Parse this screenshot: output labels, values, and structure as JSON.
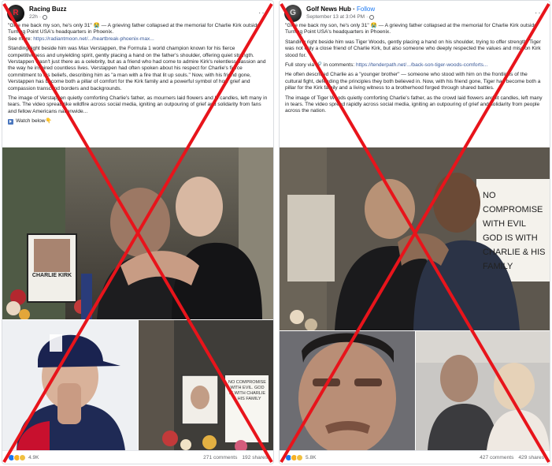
{
  "left": {
    "page_name": "Racing Buzz",
    "time": "22h",
    "quote": "\"Give me back my son, he's only 31\" 😭 — A grieving father collapsed at the memorial for Charlie Kirk outside Turning Point USA's headquarters in Phoenix.",
    "see_more_label": "See more:",
    "see_more_link": "https://radiantmoon.net/.../heartbreak-phoenix-max...",
    "para1": "Standing right beside him was Max Verstappen, the Formula 1 world champion known for his fierce competitiveness and unyielding spirit, gently placing a hand on the father's shoulder, offering quiet strength. Verstappen wasn't just there as a celebrity, but as a friend who had come to admire Kirk's relentless passion and the way he inspired countless lives. Verstappen had often spoken about his respect for Charlie's fierce commitment to his beliefs, describing him as \"a man with a fire that lit up souls.\" Now, with his friend gone, Verstappen has become both a pillar of comfort for the Kirk family and a powerful symbol of how grief and compassion transcend borders and backgrounds.",
    "para2": "The image of Verstappen quietly comforting Charlie's father, as mourners laid flowers and lit candles, left many in tears. The video spread like wildfire across social media, igniting an outpouring of grief and solidarity from fans and fellow Americans nationwide...",
    "watch_label": "Watch below👇",
    "photo_sign_name": "CHARLIE KIRK",
    "photo_sign2": "NO COMPROMISE WITH EVIL. GOD IS WITH CHARLIE & HIS FAMILY",
    "reaction_count": "4.9K",
    "comments": "271 comments",
    "shares": "192 shares"
  },
  "right": {
    "page_name": "Golf News Hub",
    "follow_label": "Follow",
    "time": "September 13 at 3:04 PM",
    "quote": "\"Give me back my son, he's only 31\" 😭 — A grieving father collapsed at the memorial for Charlie Kirk outside Turning Point USA's headquarters in Phoenix.",
    "para1": "Standing right beside him was Tiger Woods, gently placing a hand on his shoulder, trying to offer strength. Tiger was not only a close friend of Charlie Kirk, but also someone who deeply respected the values and mission Kirk stood for.",
    "full_story_label": "Full story via 🔗 in comments:",
    "full_story_link": "https://tenderpath.net/.../back-son-tiger-woods-comforts...",
    "para2": "He often described Charlie as a \"younger brother\" — someone who stood with him on the frontlines of the cultural fight, defending the principles they both believed in. Now, with his friend gone, Tiger has become both a pillar for the Kirk family and a living witness to a brotherhood forged through shared battles.",
    "para3": "The image of Tiger Woods quietly comforting Charlie's father, as the crowd laid flowers and lit candles, left many in tears. The video spread rapidly across social media, igniting an outpouring of grief and solidarity from people across the nation.",
    "photo_sign": "NO COMPROMISE WITH EVIL GOD IS WITH CHARLIE & HIS FAMILY",
    "reaction_count": "5.8K",
    "comments": "427 comments",
    "shares": "429 shares"
  },
  "colors": {
    "cross": "#e8141b",
    "link": "#385898",
    "follow": "#1877f2"
  }
}
